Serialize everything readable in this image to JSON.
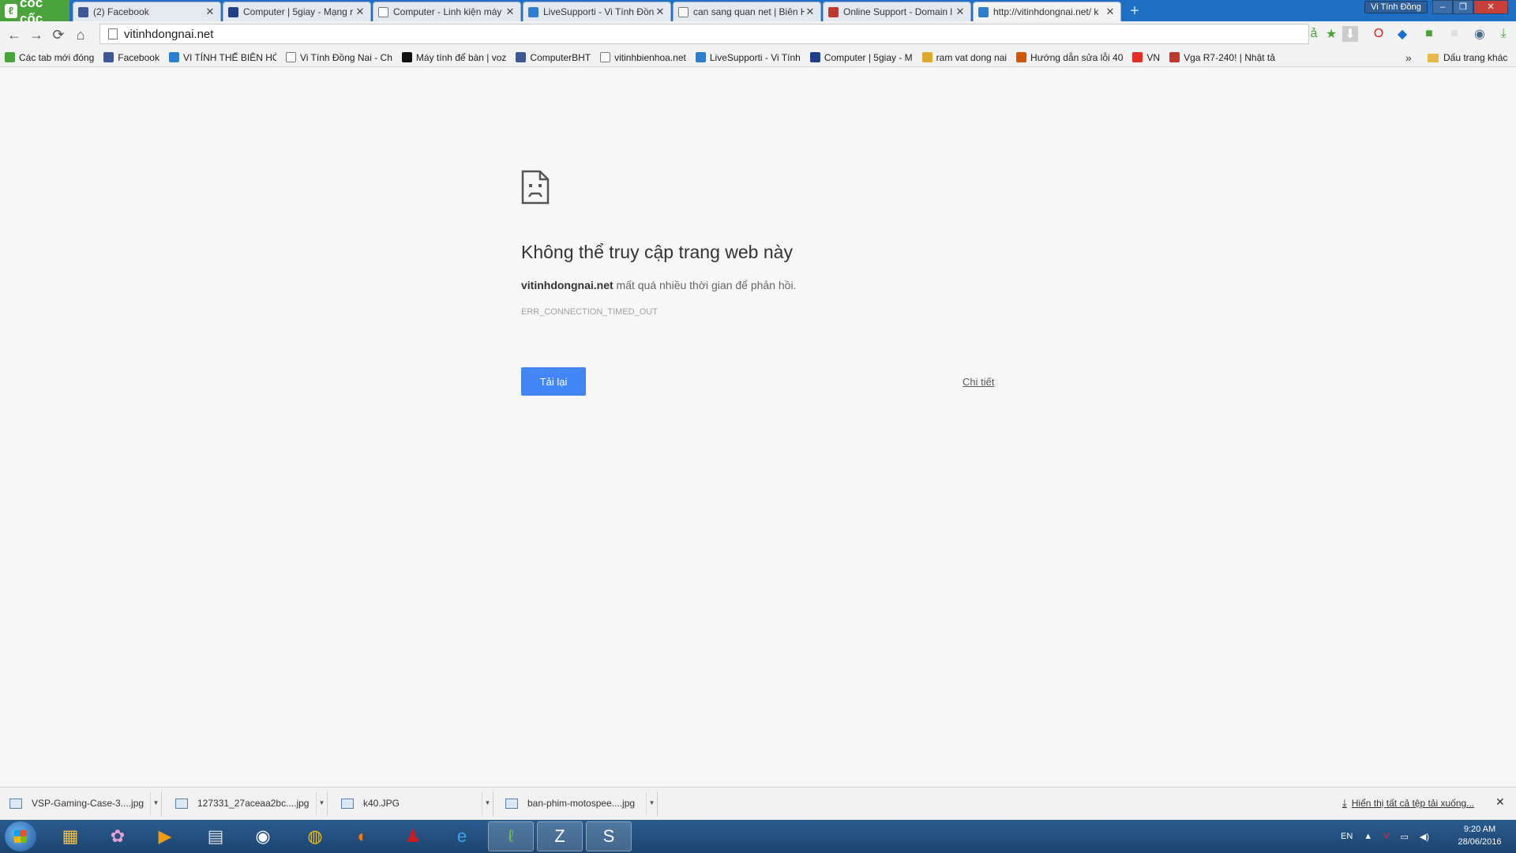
{
  "browser": {
    "logo_text": "cốc cốc",
    "profile_name": "Vi Tính Đồng",
    "tabs": [
      {
        "title": "(2) Facebook",
        "icon": "facebook-icon",
        "color": "#3b5998"
      },
      {
        "title": "Computer | 5giay - Mạng r",
        "icon": "5giay-icon",
        "color": "#1e3f8a"
      },
      {
        "title": "Computer - Linh kiện máy",
        "icon": "page-icon",
        "color": "#ffffff"
      },
      {
        "title": "LiveSupporti - Vi Tính Đồn",
        "icon": "livesupport-icon",
        "color": "#2b7fd1"
      },
      {
        "title": "can sang quan net | Biên H",
        "icon": "page-icon",
        "color": "#ffffff"
      },
      {
        "title": "Online Support - Domain l",
        "icon": "online-support-icon",
        "color": "#c0392b"
      },
      {
        "title": "http://vitinhdongnai.net/ k",
        "icon": "globe-icon",
        "color": "#2b7fd1"
      }
    ],
    "address": "vitinhdongnai.net"
  },
  "bookmarks": [
    {
      "label": "Các tab mới đóng",
      "icon": "recent-tabs-icon",
      "color": "#4aa33b"
    },
    {
      "label": "Facebook",
      "icon": "facebook-icon",
      "color": "#3b5998"
    },
    {
      "label": "VI TÍNH THẾ BIÊN HÒ",
      "icon": "globe-icon",
      "color": "#2b7fd1"
    },
    {
      "label": "Vi Tính Đồng Nai - Ch",
      "icon": "page-icon",
      "color": "#ffffff"
    },
    {
      "label": "Máy tính để bàn | voz",
      "icon": "voz-icon",
      "color": "#111111"
    },
    {
      "label": "ComputerBHT",
      "icon": "facebook-icon",
      "color": "#3b5998"
    },
    {
      "label": "vitinhbienhoa.net",
      "icon": "page-icon",
      "color": "#ffffff"
    },
    {
      "label": "LiveSupporti - Vi Tính",
      "icon": "livesupport-icon",
      "color": "#2b7fd1"
    },
    {
      "label": "Computer | 5giay - M",
      "icon": "5giay-icon",
      "color": "#1e3f8a"
    },
    {
      "label": "ram vat dong nai",
      "icon": "classified-icon",
      "color": "#e0a82e"
    },
    {
      "label": "Hướng dẫn sửa lỗi 40",
      "icon": "sos-icon",
      "color": "#d35400"
    },
    {
      "label": "VN",
      "icon": "youtube-icon",
      "color": "#e52d27"
    },
    {
      "label": "Vga R7-240! | Nhật tả",
      "icon": "vga-icon",
      "color": "#c0392b"
    }
  ],
  "bookmarks_folder": "Dấu trang khác",
  "error": {
    "title": "Không thể truy cập trang web này",
    "host": "vitinhdongnai.net",
    "message": " mất quá nhiều thời gian để phản hồi.",
    "code": "ERR_CONNECTION_TIMED_OUT",
    "reload_label": "Tải lại",
    "details_label": "Chi tiết"
  },
  "downloads": {
    "items": [
      "VSP-Gaming-Case-3....jpg",
      "127331_27aceaa2bc....jpg",
      "k40.JPG",
      "ban-phim-motospee....jpg"
    ],
    "show_all": "Hiển thị tất cả tệp tải xuống..."
  },
  "taskbar": {
    "language": "EN",
    "time": "9:20 AM",
    "date": "28/06/2016"
  }
}
